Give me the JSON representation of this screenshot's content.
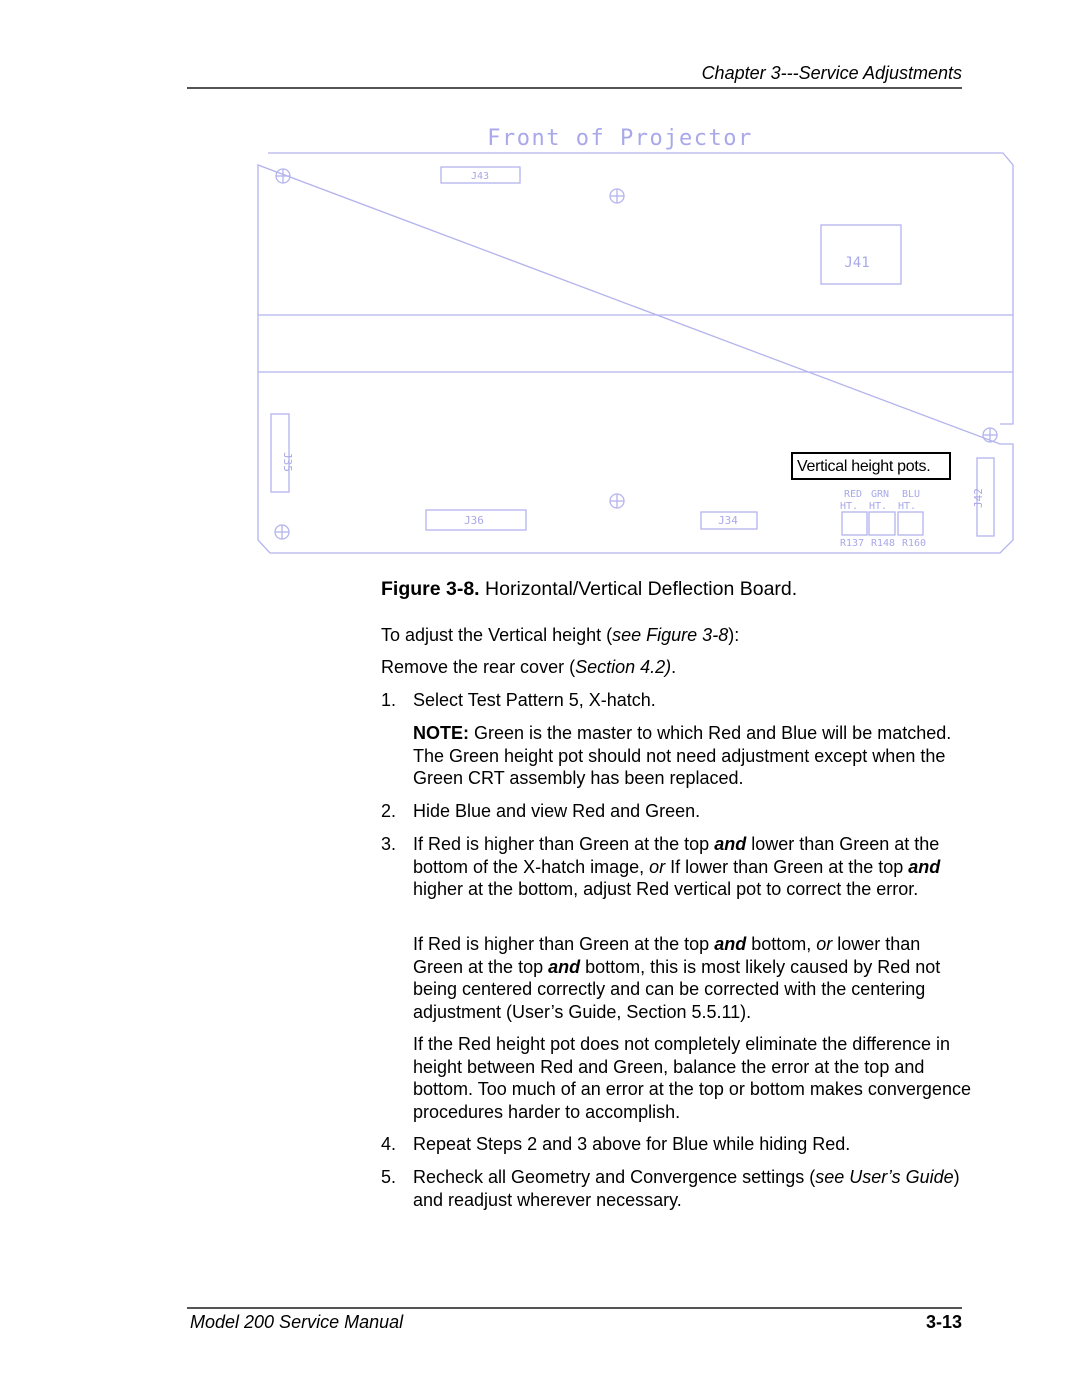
{
  "header": {
    "chapter_title": "Chapter 3---Service Adjustments"
  },
  "figure": {
    "diagram_title": "Front of Projector",
    "connectors": [
      "J43",
      "J41",
      "J35",
      "J36",
      "J34",
      "J42"
    ],
    "callout": "Vertical height pots.",
    "pots": [
      {
        "label_line1": "RED",
        "label_line2": "HT.",
        "ref": "R137"
      },
      {
        "label_line1": "GRN",
        "label_line2": "HT.",
        "ref": "R148"
      },
      {
        "label_line1": "BLU",
        "label_line2": "HT.",
        "ref": "R160"
      }
    ],
    "caption_number": "Figure 3-8.",
    "caption_text": " Horizontal/Vertical Deflection Board."
  },
  "body": {
    "intro": {
      "pre": "To adjust the Vertical height (",
      "ref": "see Figure 3-8",
      "post": "):"
    },
    "remove": {
      "pre": "Remove the rear cover (",
      "ref": "Section 4.2)",
      "post": "."
    },
    "steps": [
      {
        "number": "1.",
        "text": "Select Test Pattern 5, X-hatch."
      },
      {
        "number": "2.",
        "text": "Hide Blue and view Red and Green."
      },
      {
        "number": "3."
      },
      {
        "number": "4.",
        "text": "Repeat Steps 2 and 3 above for Blue while hiding Red."
      },
      {
        "number": "5."
      }
    ],
    "note": {
      "label": "NOTE:",
      "text": " Green is the master to which Red and Blue will be matched. The Green height pot should not need adjustment except when the Green CRT assembly has been replaced."
    },
    "step3": {
      "a": "If Red is higher than Green at the top ",
      "b": "and",
      "c": " lower than Green at the bottom of the X-hatch image, ",
      "d": "or",
      "e": " If lower than Green at the top ",
      "f": "and",
      "g": " higher at the bottom, adjust Red vertical pot to correct the error."
    },
    "step3_para2": {
      "a": "If Red is higher than Green at the top ",
      "b": "and",
      "c": " bottom, ",
      "d": "or",
      "e": " lower than Green at the top ",
      "f": "and",
      "g": " bottom, this is most likely caused by Red not being centered correctly and can be corrected with the centering adjustment (User’s Guide, Section 5.5.11)."
    },
    "step3_para3": "If the Red height pot does not completely eliminate the difference in height between Red and Green, balance the error at the top and bottom. Too much of an error at the top or bottom makes convergence procedures harder to accomplish.",
    "step5": {
      "a": "Recheck all Geometry and Convergence settings (",
      "b": "see User’s Guide",
      "c": ") and readjust wherever necessary."
    }
  },
  "footer": {
    "manual_title": "Model 200 Service Manual",
    "page_number": "3-13"
  }
}
